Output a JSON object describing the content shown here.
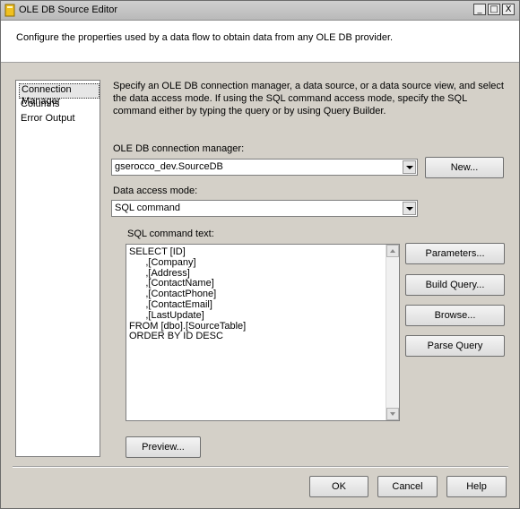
{
  "window": {
    "title": "OLE DB Source Editor",
    "minimize_glyph": "_",
    "maximize_glyph": "□",
    "close_glyph": "X"
  },
  "header": {
    "description": "Configure the properties used by a data flow to obtain data from any OLE DB provider."
  },
  "nav": {
    "items": [
      {
        "label": "Connection Manager",
        "selected": true
      },
      {
        "label": "Columns",
        "selected": false
      },
      {
        "label": "Error Output",
        "selected": false
      }
    ]
  },
  "main": {
    "description": "Specify an OLE DB connection manager, a data source, or a data source view, and select the data access mode. If using the SQL command access mode, specify the SQL command either by typing the query or by using Query Builder.",
    "connection_label": "OLE DB connection manager:",
    "connection_value": "gserocco_dev.SourceDB",
    "new_button": "New...",
    "access_mode_label": "Data access mode:",
    "access_mode_value": "SQL command",
    "sql_label": "SQL command text:",
    "sql_text": "SELECT [ID]\n      ,[Company]\n      ,[Address]\n      ,[ContactName]\n      ,[ContactPhone]\n      ,[ContactEmail]\n      ,[LastUpdate]\nFROM [dbo].[SourceTable]\nORDER BY ID DESC",
    "parameters_button": "Parameters...",
    "build_query_button": "Build Query...",
    "browse_button": "Browse...",
    "parse_query_button": "Parse Query",
    "preview_button": "Preview..."
  },
  "footer": {
    "ok_button": "OK",
    "cancel_button": "Cancel",
    "help_button": "Help"
  }
}
